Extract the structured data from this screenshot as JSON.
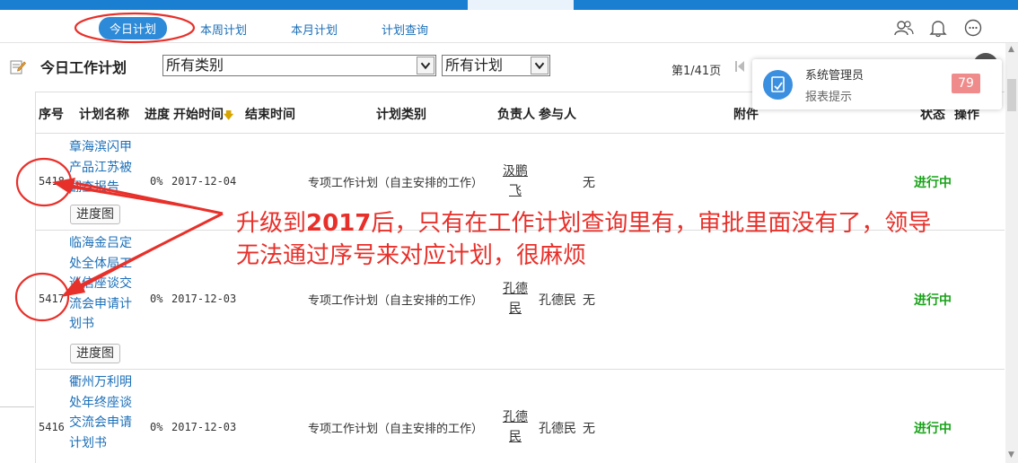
{
  "colors": {
    "topbar": "#1a7fd1",
    "link": "#1b6fb8",
    "status_green": "#19a319",
    "annotation_red": "#e8302a",
    "badge_pink": "#f08b8b"
  },
  "sub_tabs": [
    {
      "label": "今日计划",
      "active": true
    },
    {
      "label": "本周计划",
      "active": false
    },
    {
      "label": "本月计划",
      "active": false
    },
    {
      "label": "计划查询",
      "active": false
    }
  ],
  "header_icons": [
    "users-icon",
    "bell-icon",
    "chat-icon"
  ],
  "page": {
    "title": "今日工作计划",
    "category_select": "所有类别",
    "plan_select": "所有计划",
    "pager_text": "第1/41页"
  },
  "notification": {
    "name": "系统管理员",
    "subtitle": "报表提示",
    "count": "79"
  },
  "table": {
    "headers": {
      "seq": "序号",
      "name": "计划名称",
      "progress": "进度",
      "start": "开始时间",
      "end": "结束时间",
      "type": "计划类别",
      "owner": "负责人",
      "participants": "参与人",
      "attachment": "附件",
      "status": "状态",
      "ops": "操作"
    },
    "rows": [
      {
        "seq": "5418",
        "name": "章海滨闪甲产品江苏被翻查报告",
        "progress": "0%",
        "start": "2017-12-04",
        "type": "专项工作计划（自主安排的工作）",
        "owner": "汲鹏飞",
        "participants": "",
        "attachment": "无",
        "status": "进行中",
        "button": "进度图"
      },
      {
        "seq": "5417",
        "name": "临海金吕定处全体局工巡信座谈交流会申请计划书",
        "progress": "0%",
        "start": "2017-12-03",
        "type": "专项工作计划（自主安排的工作）",
        "owner": "孔德民",
        "participants": "孔德民",
        "attachment": "无",
        "status": "进行中",
        "button": "进度图"
      },
      {
        "seq": "5416",
        "name": "衢州万利明处年终座谈交流会申请计划书",
        "progress": "0%",
        "start": "2017-12-03",
        "type": "专项工作计划（自主安排的工作）",
        "owner": "孔德民",
        "participants": "孔德民",
        "attachment": "无",
        "status": "进行中",
        "button": ""
      }
    ]
  },
  "annotation": {
    "line1_a": "升级到",
    "line1_year": "2017",
    "line1_b": "后，只有在工作计划查询里有，审批里面没有了，领导",
    "line2": "无法通过序号来对应计划，很麻烦"
  }
}
